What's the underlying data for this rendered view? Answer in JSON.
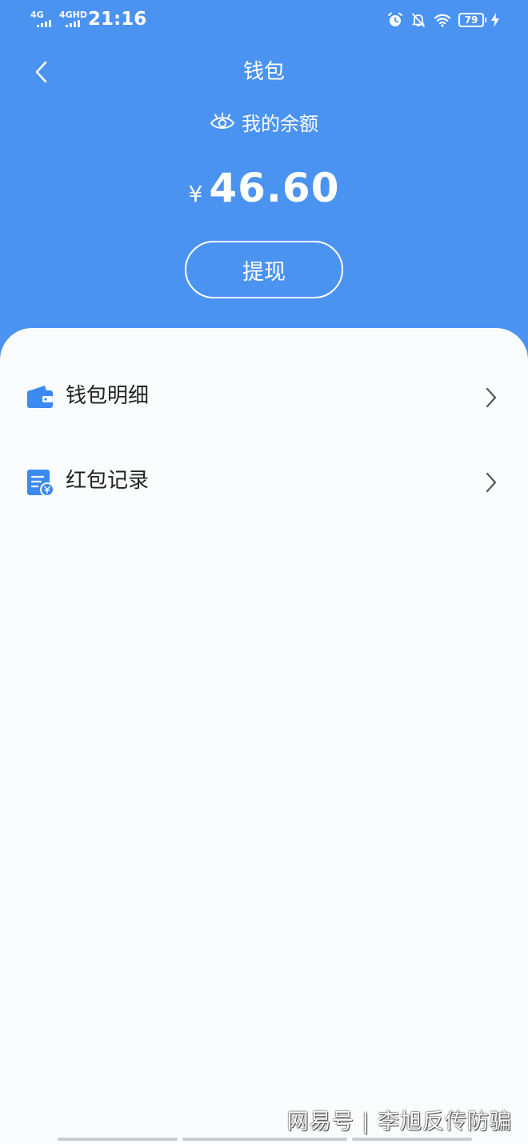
{
  "status_bar": {
    "signal_1": "4G",
    "signal_2": "4GHD",
    "time": "21:16",
    "battery": "79",
    "icons": [
      "alarm-icon",
      "mute-bell-icon",
      "wifi-icon",
      "battery-icon",
      "charging-icon"
    ]
  },
  "header": {
    "title": "钱包",
    "balance_label": "我的余额",
    "currency": "¥",
    "balance": "46.60",
    "withdraw_label": "提现",
    "background_color": "#4b93f1"
  },
  "menu": {
    "items": [
      {
        "label": "钱包明细",
        "icon": "wallet-icon"
      },
      {
        "label": "红包记录",
        "icon": "red-packet-record-icon"
      }
    ],
    "icon_color": "#3b8af0"
  },
  "watermark": {
    "text": "网易号 | 李旭反传防骗"
  }
}
